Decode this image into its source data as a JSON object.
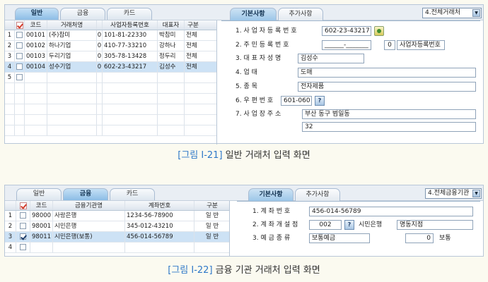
{
  "figure1": {
    "tabs": [
      "일반",
      "금융",
      "카드"
    ],
    "filter_value": "4.전체거래처",
    "columns": [
      "",
      "코드",
      "거래처명",
      "",
      "사업자등록번호",
      "대표자",
      "구분"
    ],
    "rows": [
      {
        "num": "1",
        "checked": false,
        "code": "00101",
        "name": "(주)참미",
        "type": "0",
        "biz": "101-81-22330",
        "rep": "박참미",
        "div": "전체"
      },
      {
        "num": "2",
        "checked": false,
        "code": "00102",
        "name": "하나기업",
        "type": "0",
        "biz": "410-77-33210",
        "rep": "강하나",
        "div": "전체"
      },
      {
        "num": "3",
        "checked": false,
        "code": "00103",
        "name": "두리기업",
        "type": "0",
        "biz": "305-78-13428",
        "rep": "정두리",
        "div": "전체"
      },
      {
        "num": "4",
        "checked": false,
        "code": "00104",
        "name": "성수기업",
        "type": "0",
        "biz": "602-23-43217",
        "rep": "김성수",
        "div": "전체"
      },
      {
        "num": "5",
        "checked": false,
        "code": "",
        "name": "",
        "type": "",
        "biz": "",
        "rep": "",
        "div": ""
      }
    ],
    "right_tabs": [
      "기본사항",
      "추가사항"
    ],
    "form": [
      {
        "label": "1. 사 업 자 등 록 번 호",
        "value": "602-23-43217"
      },
      {
        "label": "2. 주 민 등 록 번 호",
        "value": "______-_______",
        "extra_value": "0",
        "extra_label": "사업자등록번호"
      },
      {
        "label": "3. 대 표 자 성 명",
        "value": "김성수"
      },
      {
        "label": "4. 업            태",
        "value": "도매"
      },
      {
        "label": "5. 종            목",
        "value": "전자제품"
      },
      {
        "label": "6. 우   편   번   호",
        "value": "601-060"
      },
      {
        "label": "7. 사 업 장 주 소",
        "value": "부산 동구 범일동",
        "value2": "32"
      }
    ],
    "caption_tag": "[그림 Ⅰ-21]",
    "caption_text": "일반 거래처 입력 화면"
  },
  "figure2": {
    "tabs": [
      "일반",
      "금융",
      "카드"
    ],
    "filter_value": "4.전체금융기관",
    "columns": [
      "",
      "코드",
      "금융기관명",
      "계좌번호",
      "구분"
    ],
    "rows": [
      {
        "num": "1",
        "checked": false,
        "code": "98000",
        "name": "사랑은행",
        "account": "1234-56-78900",
        "div": "일    반"
      },
      {
        "num": "2",
        "checked": false,
        "code": "98001",
        "name": "시민은행",
        "account": "345-012-43210",
        "div": "일    반"
      },
      {
        "num": "3",
        "checked": true,
        "code": "98011",
        "name": "시민은행(보통)",
        "account": "456-014-56789",
        "div": "일    반"
      },
      {
        "num": "4",
        "checked": false,
        "code": "",
        "name": "",
        "account": "",
        "div": ""
      }
    ],
    "right_tabs": [
      "기본사항",
      "추가사항"
    ],
    "form": [
      {
        "label": "1. 계    좌    번    호",
        "value": "456-014-56789"
      },
      {
        "label": "2. 계 좌 개 설 점",
        "value": "002",
        "bank": "시민은행",
        "branch": "명동지점"
      },
      {
        "label": "3. 예   금   종   류",
        "value": "보통예금",
        "extra_value": "0",
        "extra_label": "보통"
      }
    ],
    "caption_tag": "[그림 Ⅰ-22]",
    "caption_text": "금융 기관 거래처 입력 화면"
  },
  "colors": {
    "accent": "#2e78c8",
    "selected_row": "#cde2f5",
    "tab_active": "#9cc6e8",
    "background": "#fbfaf0"
  }
}
